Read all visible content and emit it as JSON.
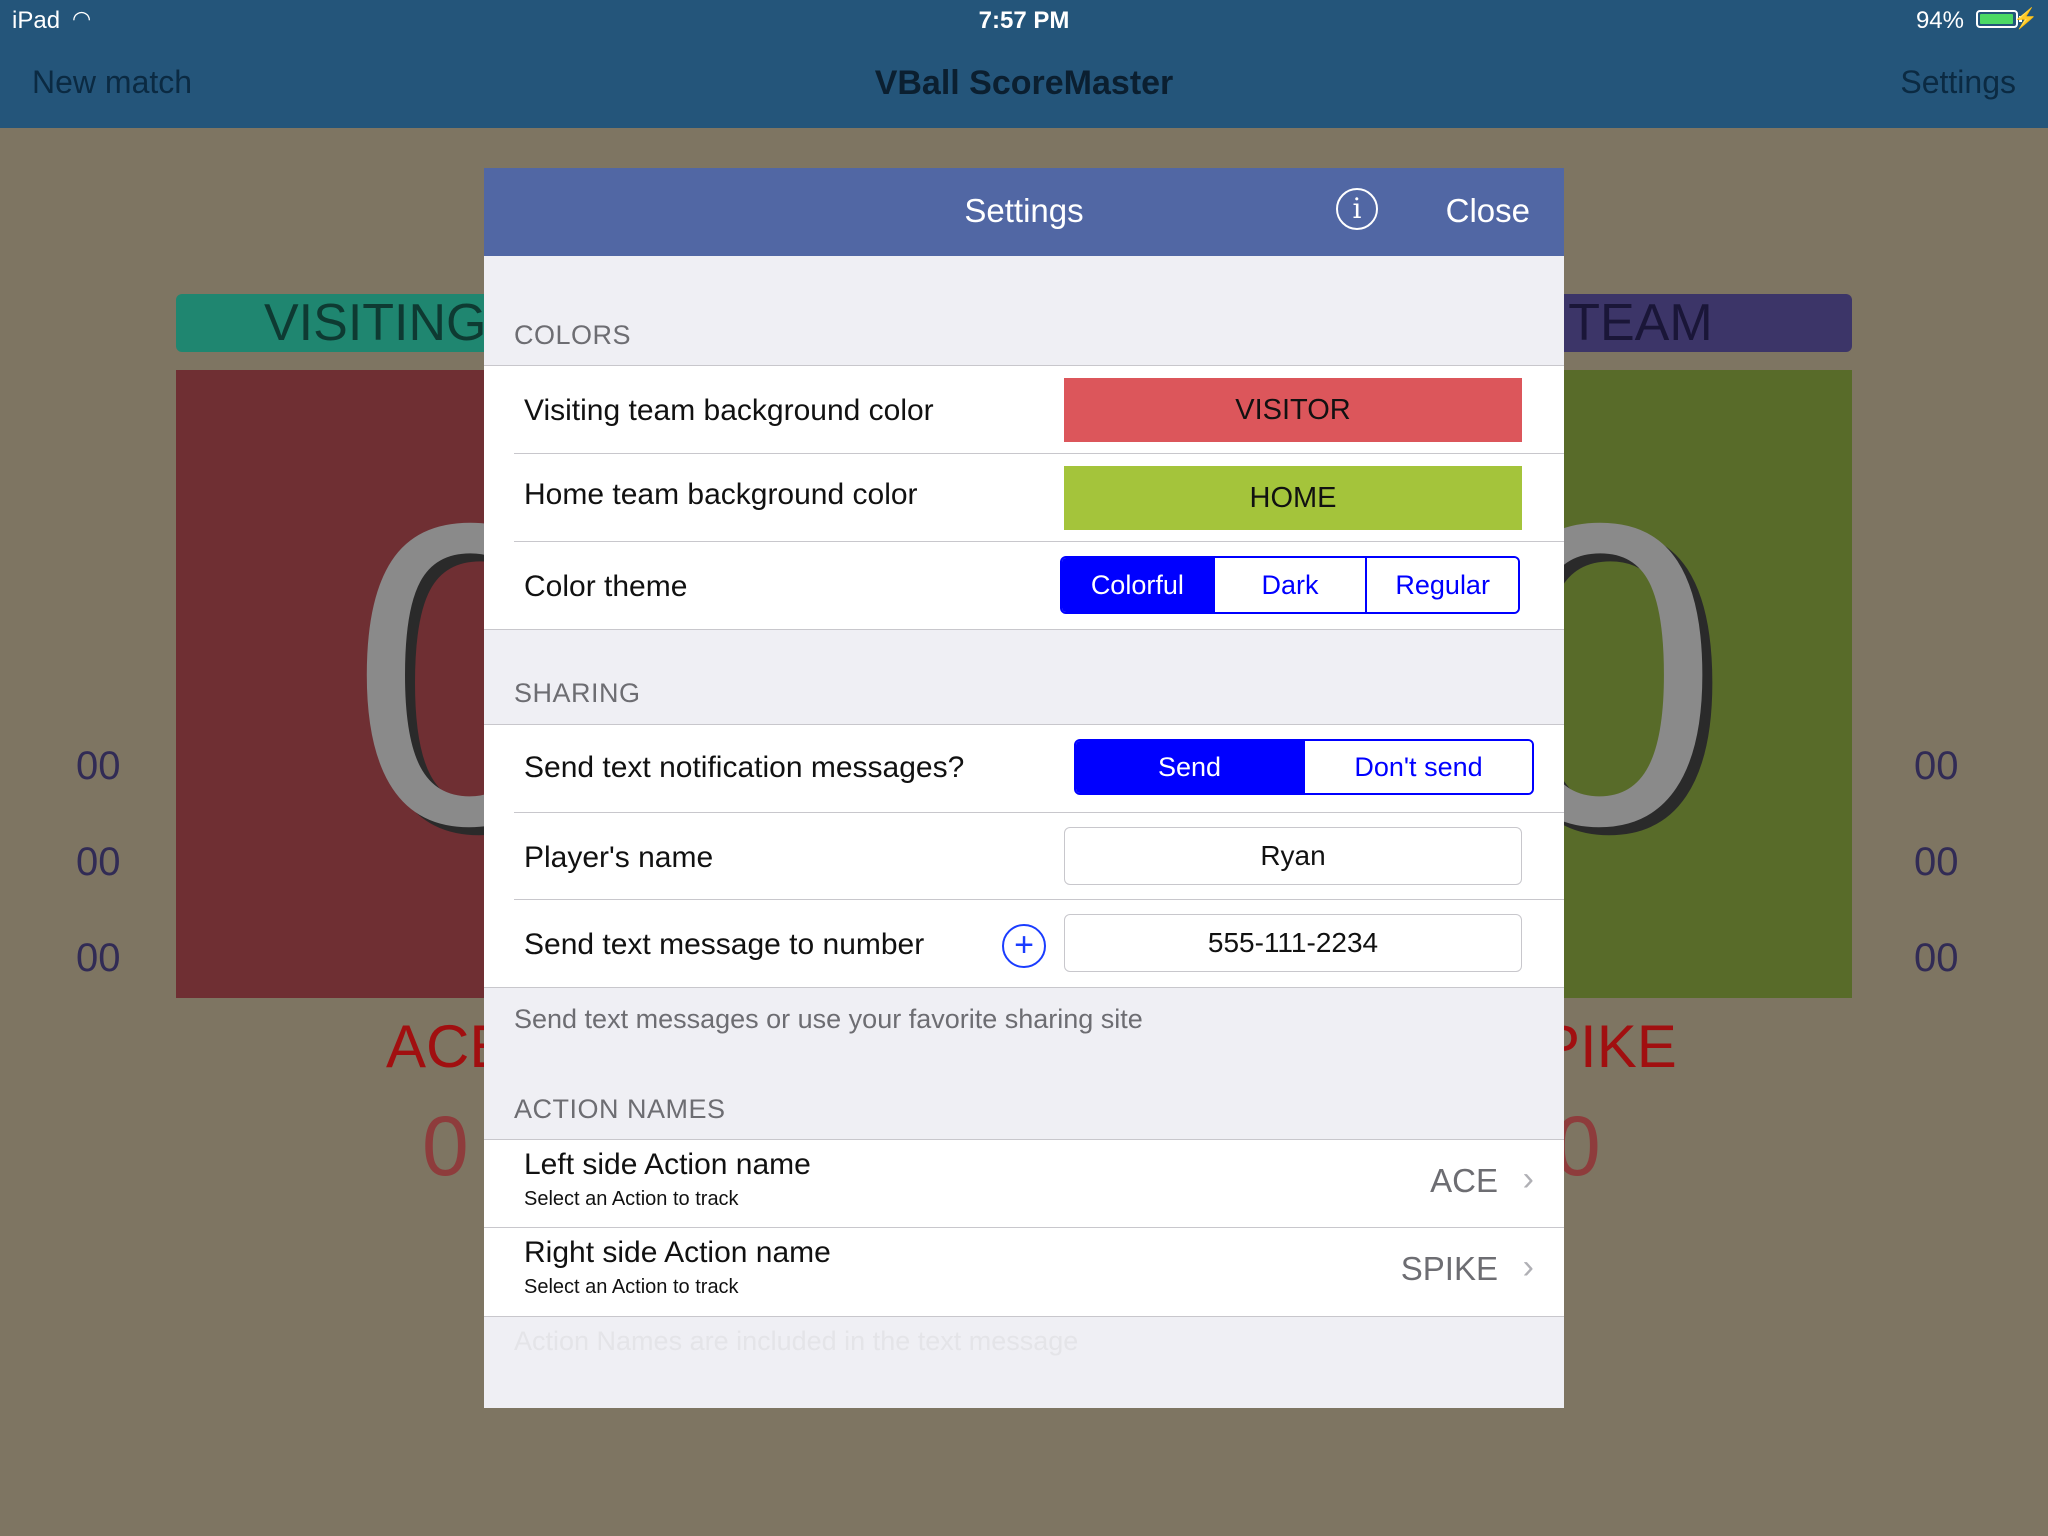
{
  "status_bar": {
    "carrier": "iPad",
    "time": "7:57 PM",
    "battery_pct": "94%",
    "battery_level": 0.94
  },
  "navbar": {
    "left": "New match",
    "title": "VBall ScoreMaster",
    "right": "Settings"
  },
  "background": {
    "visiting_header": "VISITING",
    "home_header": "E TEAM",
    "visiting_score": "0",
    "home_score": "0",
    "side_values": [
      "00",
      "00",
      "00"
    ],
    "left_action": "ACE",
    "right_action": "PIKE",
    "left_action_count": "0",
    "right_action_count": "0"
  },
  "modal": {
    "title": "Settings",
    "info_glyph": "i",
    "close": "Close",
    "colors": {
      "section": "COLORS",
      "visiting_label": "Visiting team background color",
      "visiting_swatch": "VISITOR",
      "visiting_color": "#dc565b",
      "home_label": "Home team background color",
      "home_swatch": "HOME",
      "home_color": "#a4c43b",
      "theme_label": "Color theme",
      "theme_options": [
        "Colorful",
        "Dark",
        "Regular"
      ],
      "theme_selected": "Colorful"
    },
    "sharing": {
      "section": "SHARING",
      "notify_label": "Send text notification messages?",
      "notify_options": [
        "Send",
        "Don't send"
      ],
      "notify_selected": "Send",
      "player_label": "Player's name",
      "player_value": "Ryan",
      "number_label": "Send text message to number",
      "number_value": "555-111-2234",
      "footer": "Send text messages or use your favorite sharing site"
    },
    "action_names": {
      "section": "ACTION NAMES",
      "left_label": "Left side Action name",
      "left_sub": "Select an Action to track",
      "left_value": "ACE",
      "right_label": "Right side Action name",
      "right_sub": "Select an Action to track",
      "right_value": "SPIKE",
      "footer": "Action Names are included in the text message"
    }
  },
  "accent_color": "#0000ff"
}
